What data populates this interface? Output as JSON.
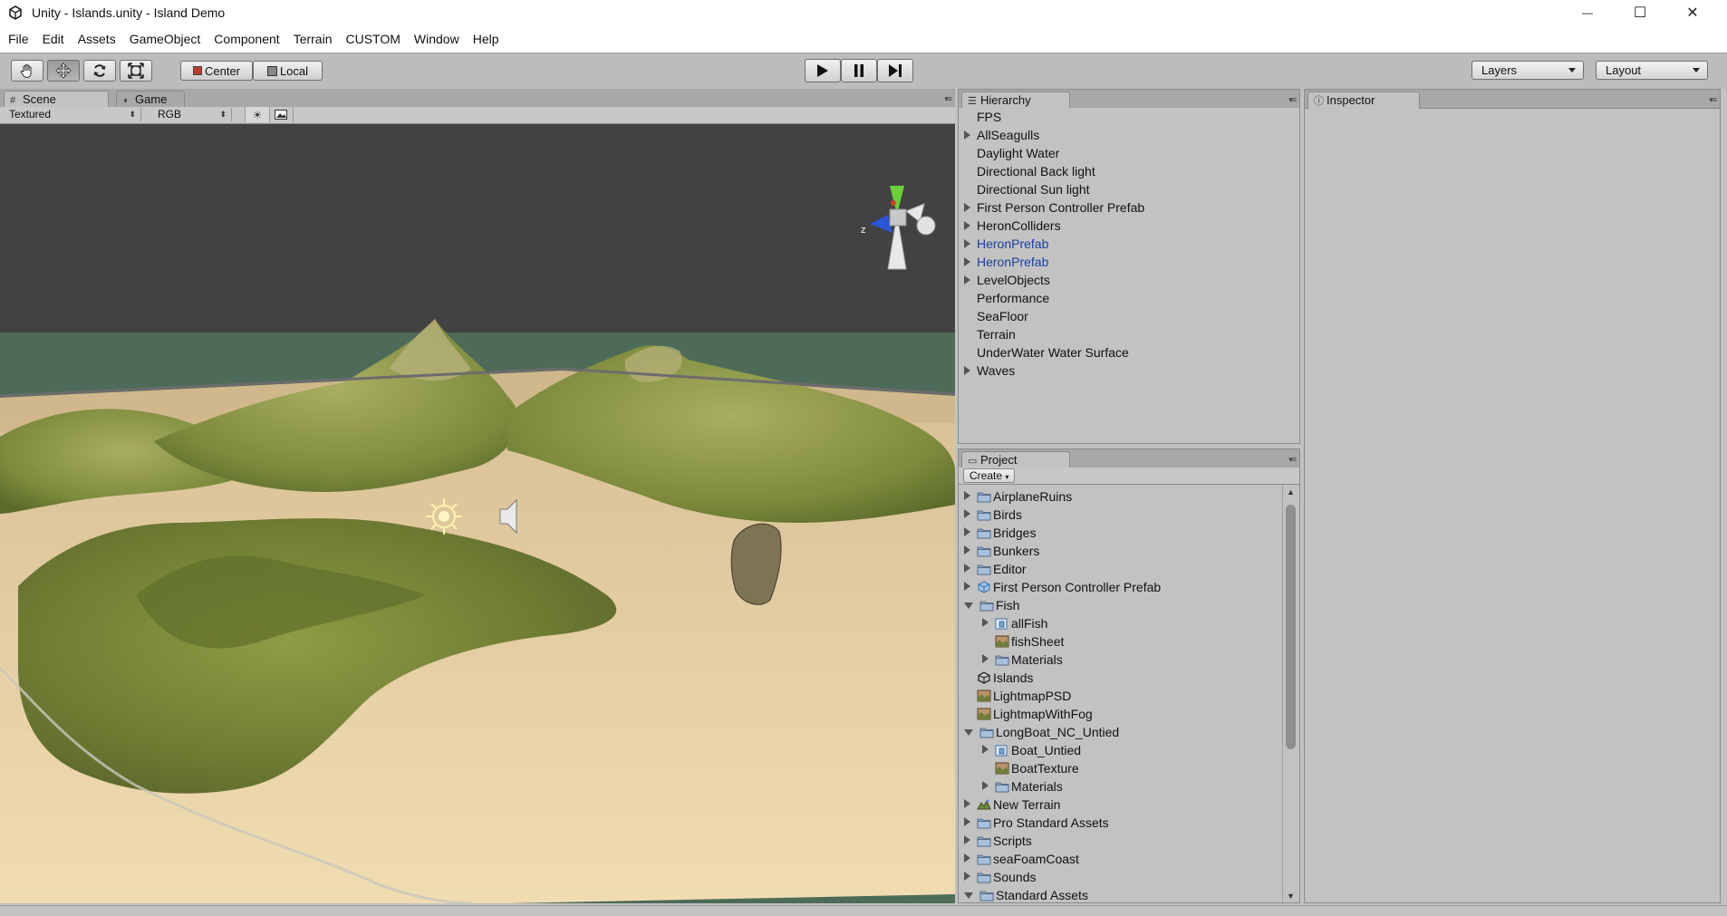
{
  "window": {
    "title": "Unity - Islands.unity - Island Demo",
    "minimize_glyph": "—",
    "maximize_glyph": "☐",
    "close_glyph": "✕"
  },
  "menu": [
    "File",
    "Edit",
    "Assets",
    "GameObject",
    "Component",
    "Terrain",
    "CUSTOM",
    "Window",
    "Help"
  ],
  "toolbar": {
    "tools": [
      "hand-icon",
      "move-icon",
      "rotate-icon",
      "scale-icon"
    ],
    "pivot_mode": "Center",
    "pivot_rotation": "Local",
    "play_controls": [
      "play-icon",
      "pause-icon",
      "step-icon"
    ],
    "layers_label": "Layers",
    "layout_label": "Layout"
  },
  "scene_panel": {
    "tabs": [
      "Scene",
      "Game"
    ],
    "active_tab": "Scene",
    "render_mode": "Textured",
    "color_mode": "RGB",
    "gizmo_axis_label": "z",
    "colors": {
      "water": "#4d6b58",
      "sky": "#424242",
      "sand": "#e3c9a0",
      "grass": "#7a8a3a"
    }
  },
  "hierarchy": {
    "tab": "Hierarchy",
    "items": [
      {
        "label": "FPS",
        "arrow": false,
        "prefab": false
      },
      {
        "label": "AllSeagulls",
        "arrow": true,
        "prefab": false
      },
      {
        "label": "Daylight Water",
        "arrow": false,
        "prefab": false
      },
      {
        "label": "Directional Back light",
        "arrow": false,
        "prefab": false
      },
      {
        "label": "Directional Sun light",
        "arrow": false,
        "prefab": false
      },
      {
        "label": "First Person Controller Prefab",
        "arrow": true,
        "prefab": false
      },
      {
        "label": "HeronColliders",
        "arrow": true,
        "prefab": false
      },
      {
        "label": "HeronPrefab",
        "arrow": true,
        "prefab": true
      },
      {
        "label": "HeronPrefab",
        "arrow": true,
        "prefab": true
      },
      {
        "label": "LevelObjects",
        "arrow": true,
        "prefab": false
      },
      {
        "label": "Performance",
        "arrow": false,
        "prefab": false
      },
      {
        "label": "SeaFloor",
        "arrow": false,
        "prefab": false
      },
      {
        "label": "Terrain",
        "arrow": false,
        "prefab": false
      },
      {
        "label": "UnderWater Water Surface",
        "arrow": false,
        "prefab": false
      },
      {
        "label": "Waves",
        "arrow": true,
        "prefab": false
      }
    ]
  },
  "project": {
    "tab": "Project",
    "create_label": "Create",
    "items": [
      {
        "label": "AirplaneRuins",
        "depth": 0,
        "arrow": "closed",
        "icon": "folder-icon"
      },
      {
        "label": "Birds",
        "depth": 0,
        "arrow": "closed",
        "icon": "folder-icon"
      },
      {
        "label": "Bridges",
        "depth": 0,
        "arrow": "closed",
        "icon": "folder-icon"
      },
      {
        "label": "Bunkers",
        "depth": 0,
        "arrow": "closed",
        "icon": "folder-icon"
      },
      {
        "label": "Editor",
        "depth": 0,
        "arrow": "closed",
        "icon": "folder-icon"
      },
      {
        "label": "First Person Controller Prefab",
        "depth": 0,
        "arrow": "closed",
        "icon": "prefab-icon"
      },
      {
        "label": "Fish",
        "depth": 0,
        "arrow": "open",
        "icon": "folder-icon"
      },
      {
        "label": "allFish",
        "depth": 1,
        "arrow": "closed",
        "icon": "model-icon"
      },
      {
        "label": "fishSheet",
        "depth": 1,
        "arrow": "none",
        "icon": "texture-icon"
      },
      {
        "label": "Materials",
        "depth": 1,
        "arrow": "closed",
        "icon": "folder-icon"
      },
      {
        "label": "Islands",
        "depth": 0,
        "arrow": "none",
        "icon": "unity-scene-icon"
      },
      {
        "label": "LightmapPSD",
        "depth": 0,
        "arrow": "none",
        "icon": "texture-icon"
      },
      {
        "label": "LightmapWithFog",
        "depth": 0,
        "arrow": "none",
        "icon": "texture-icon"
      },
      {
        "label": "LongBoat_NC_Untied",
        "depth": 0,
        "arrow": "open",
        "icon": "folder-icon"
      },
      {
        "label": "Boat_Untied",
        "depth": 1,
        "arrow": "closed",
        "icon": "model-icon"
      },
      {
        "label": "BoatTexture",
        "depth": 1,
        "arrow": "none",
        "icon": "texture-icon"
      },
      {
        "label": "Materials",
        "depth": 1,
        "arrow": "closed",
        "icon": "folder-icon"
      },
      {
        "label": "New Terrain",
        "depth": 0,
        "arrow": "closed",
        "icon": "terrain-icon"
      },
      {
        "label": "Pro Standard Assets",
        "depth": 0,
        "arrow": "closed",
        "icon": "folder-icon"
      },
      {
        "label": "Scripts",
        "depth": 0,
        "arrow": "closed",
        "icon": "folder-icon"
      },
      {
        "label": "seaFoamCoast",
        "depth": 0,
        "arrow": "closed",
        "icon": "folder-icon"
      },
      {
        "label": "Sounds",
        "depth": 0,
        "arrow": "closed",
        "icon": "folder-icon"
      },
      {
        "label": "Standard Assets",
        "depth": 0,
        "arrow": "open",
        "icon": "folder-icon"
      }
    ]
  },
  "inspector": {
    "tab": "Inspector"
  }
}
